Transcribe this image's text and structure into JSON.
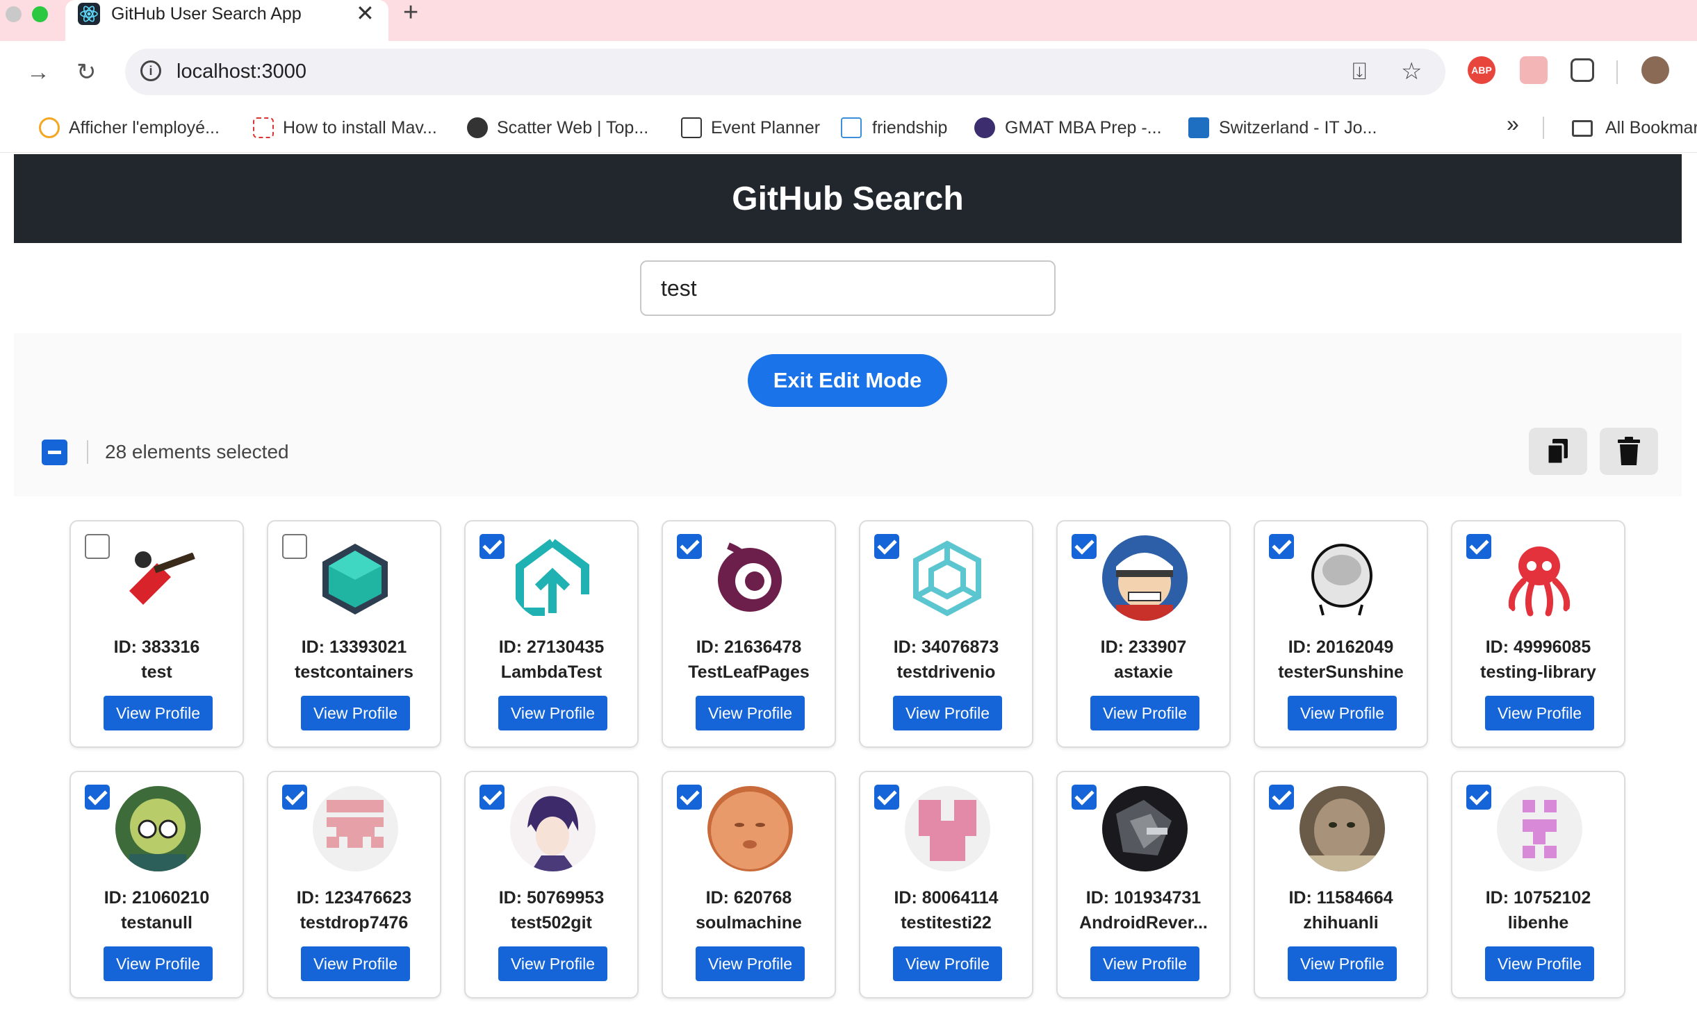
{
  "browser": {
    "tab_title": "GitHub User Search App",
    "tab_close": "✕",
    "new_tab": "+",
    "url": "localhost:3000",
    "bookmarks": [
      "Afficher l'employé...",
      "How to install Mav...",
      "Scatter Web | Top...",
      "Event Planner",
      "friendship",
      "GMAT MBA Prep -...",
      "Switzerland - IT Jo..."
    ],
    "bookmarks_more": "»",
    "all_bookmarks": "All Bookmarks"
  },
  "app": {
    "title": "GitHub Search",
    "search_value": "test",
    "exit_edit_label": "Exit Edit Mode",
    "selection_text": "28 elements selected",
    "view_profile_label": "View Profile"
  },
  "cards": [
    {
      "id": "ID: 383316",
      "name": "test",
      "checked": false
    },
    {
      "id": "ID: 13393021",
      "name": "testcontainers",
      "checked": false
    },
    {
      "id": "ID: 27130435",
      "name": "LambdaTest",
      "checked": true
    },
    {
      "id": "ID: 21636478",
      "name": "TestLeafPages",
      "checked": true
    },
    {
      "id": "ID: 34076873",
      "name": "testdrivenio",
      "checked": true
    },
    {
      "id": "ID: 233907",
      "name": "astaxie",
      "checked": true
    },
    {
      "id": "ID: 20162049",
      "name": "testerSunshine",
      "checked": true
    },
    {
      "id": "ID: 49996085",
      "name": "testing-library",
      "checked": true
    },
    {
      "id": "ID: 21060210",
      "name": "testanull",
      "checked": true
    },
    {
      "id": "ID: 123476623",
      "name": "testdrop7476",
      "checked": true
    },
    {
      "id": "ID: 50769953",
      "name": "test502git",
      "checked": true
    },
    {
      "id": "ID: 620768",
      "name": "soulmachine",
      "checked": true
    },
    {
      "id": "ID: 80064114",
      "name": "testitesti22",
      "checked": true
    },
    {
      "id": "ID: 101934731",
      "name": "AndroidRever...",
      "checked": true
    },
    {
      "id": "ID: 11584664",
      "name": "zhihuanli",
      "checked": true
    },
    {
      "id": "ID: 10752102",
      "name": "libenhe",
      "checked": true
    }
  ]
}
